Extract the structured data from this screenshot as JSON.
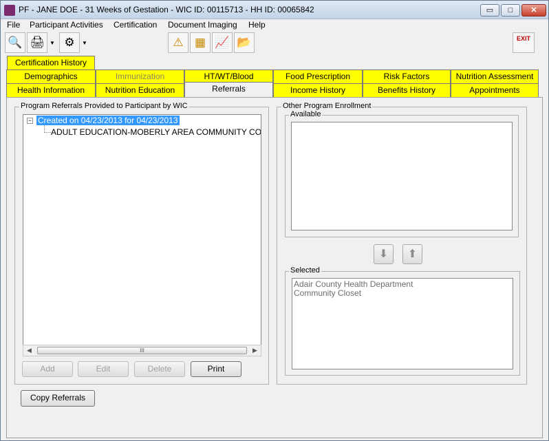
{
  "window": {
    "title": "PF - JANE DOE - 31 Weeks of Gestation - WIC ID: 00115713 - HH ID: 00065842",
    "minimize_glyph": "▭",
    "maximize_glyph": "□",
    "close_glyph": "✕"
  },
  "menu": {
    "items": [
      "File",
      "Participant Activities",
      "Certification",
      "Document Imaging",
      "Help"
    ]
  },
  "toolbar": {
    "icons": [
      "magnifier-icon",
      "printer-icon",
      "tools-icon",
      "alert-icon",
      "notes-icon",
      "chart-icon",
      "folder-icon"
    ],
    "glyphs": {
      "search": "🔍",
      "print": "🖨",
      "tools": "⚙",
      "alert": "⚠",
      "notes": "▦",
      "chart": "📈",
      "folder": "📂",
      "dropdown": "▼"
    },
    "exit_label": "EXIT"
  },
  "tabs": {
    "top": "Certification History",
    "row1": [
      "Demographics",
      "Immunization",
      "HT/WT/Blood",
      "Food Prescription",
      "Risk Factors",
      "Nutrition Assessment"
    ],
    "row2": [
      "Health Information",
      "Nutrition Education",
      "Referrals",
      "Income History",
      "Benefits History",
      "Appointments"
    ]
  },
  "referrals": {
    "group_title": "Program Referrals Provided to Participant by WIC",
    "tree_expander": "−",
    "root_node": "Created on 04/23/2013 for 04/23/2013",
    "child_node": "ADULT EDUCATION-MOBERLY AREA COMMUNITY COLLEGE",
    "scroll_left": "◀",
    "scroll_right": "▶",
    "scroll_grip": "III",
    "buttons": {
      "add": "Add",
      "edit": "Edit",
      "delete": "Delete",
      "print": "Print"
    }
  },
  "other_enrollment": {
    "group_title": "Other Program Enrollment",
    "available_label": "Available",
    "available_items": [],
    "move_down_glyph": "⬇",
    "move_up_glyph": "⬆",
    "selected_label": "Selected",
    "selected_items": [
      "Adair County Health Department",
      "Community Closet"
    ]
  },
  "footer": {
    "copy_referrals_label": "Copy Referrals"
  }
}
